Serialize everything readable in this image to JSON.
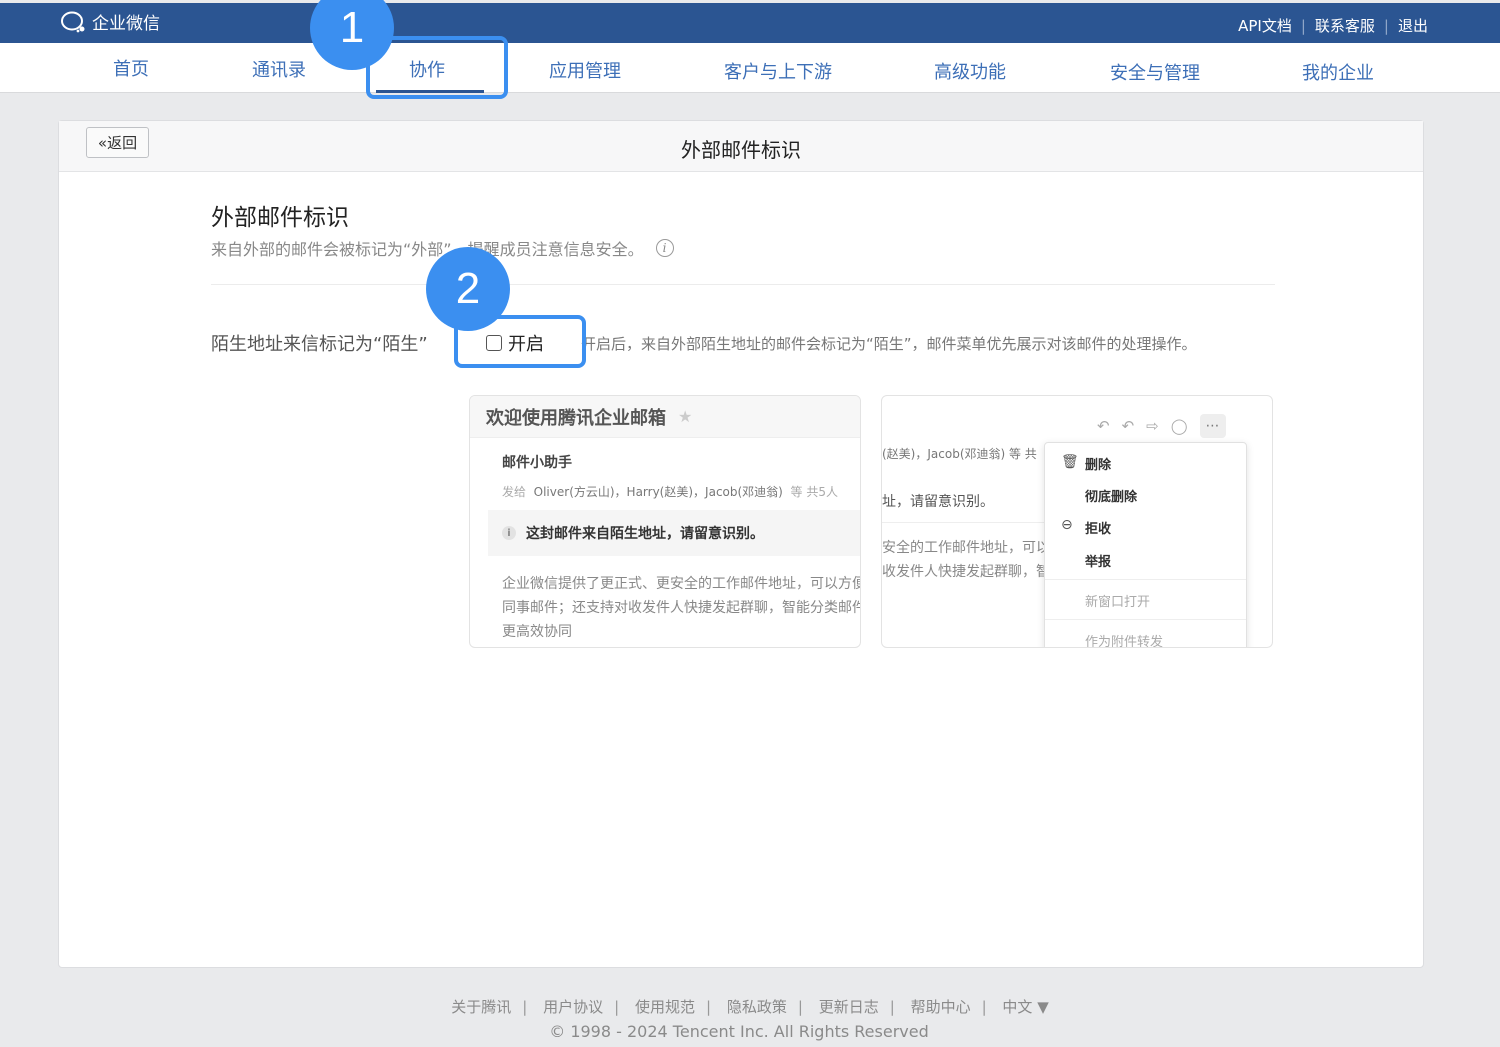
{
  "topbar": {
    "logo_text": "企业微信",
    "links": [
      "API文档",
      "联系客服",
      "退出"
    ]
  },
  "nav": {
    "items": [
      "首页",
      "通讯录",
      "协作",
      "应用管理",
      "客户与上下游",
      "高级功能",
      "安全与管理",
      "我的企业"
    ],
    "active": "协作"
  },
  "panel": {
    "back_label": "返回",
    "title": "外部邮件标识"
  },
  "section": {
    "title": "外部邮件标识",
    "description": "来自外部的邮件会被标记为“外部”，提醒成员注意信息安全。",
    "setting_label": "陌生地址来信标记为“陌生”",
    "toggle_label": "开启",
    "toggle_checked": false,
    "hint": "开启后，来自外部陌生地址的邮件会标记为“陌生”，邮件菜单优先展示对该邮件的处理操作。"
  },
  "annotations": {
    "step1": "1",
    "step2": "2"
  },
  "preview_left": {
    "subject": "欢迎使用腾讯企业邮箱",
    "star": "★",
    "sender": "邮件小助手",
    "to_label": "发给",
    "recipients": "Oliver(方云山)，Harry(赵美)，Jacob(邓迪翁)",
    "count": "等 共5人",
    "warning": "这封邮件来自陌生地址，请留意识别。",
    "body": [
      "企业微信提供了更正式、更安全的工作邮件地址，可以方便",
      "同事邮件；还支持对收发件人快捷发起群聊，智能分类邮件",
      "更高效协同"
    ]
  },
  "preview_right": {
    "recipients": "(赵美)，Jacob(邓迪翁)  等 共",
    "warning": "址，请留意识别。",
    "body": [
      "安全的工作邮件地址，可以",
      "收发件人快捷发起群聊，智"
    ],
    "menu": {
      "delete": "删除",
      "delete_permanent": "彻底删除",
      "reject": "拒收",
      "report": "举报",
      "open_new_window": "新窗口打开",
      "forward_as_attachment": "作为附件转发"
    }
  },
  "footer": {
    "links": [
      "关于腾讯",
      "用户协议",
      "使用规范",
      "隐私政策",
      "更新日志",
      "帮助中心",
      "中文 ▼"
    ],
    "copyright": "© 1998 - 2024 Tencent Inc. All Rights Reserved"
  },
  "colors": {
    "topbar": "#2b5592",
    "nav_text": "#3d6fb7",
    "highlight": "#3b8ff0"
  }
}
